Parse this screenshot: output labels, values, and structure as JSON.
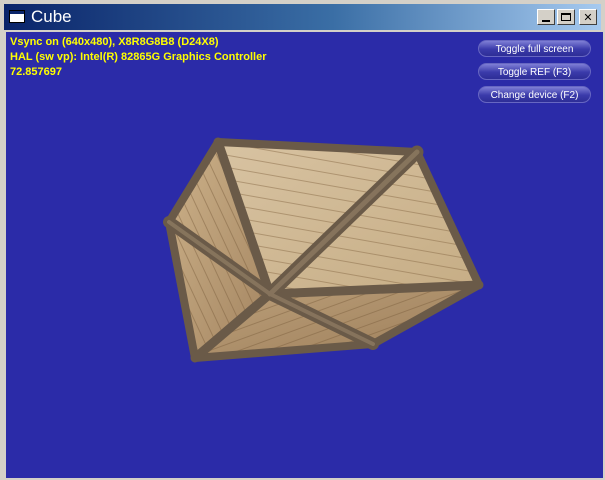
{
  "window": {
    "title": "Cube",
    "controls": {
      "minimize": "",
      "maximize": "",
      "close": "✕"
    }
  },
  "stats": {
    "line1": "Vsync on (640x480), X8R8G8B8 (D24X8)",
    "line2": "HAL (sw vp): Intel(R) 82865G Graphics Controller",
    "line3": "72.857697"
  },
  "buttons": {
    "toggle_full_screen": "Toggle full screen",
    "toggle_ref": "Toggle REF (F3)",
    "change_device": "Change device (F2)"
  },
  "colors": {
    "viewport_bg": "#2b2ba8",
    "stats_text": "#ffff00",
    "title_gradient_start": "#0a246a"
  }
}
